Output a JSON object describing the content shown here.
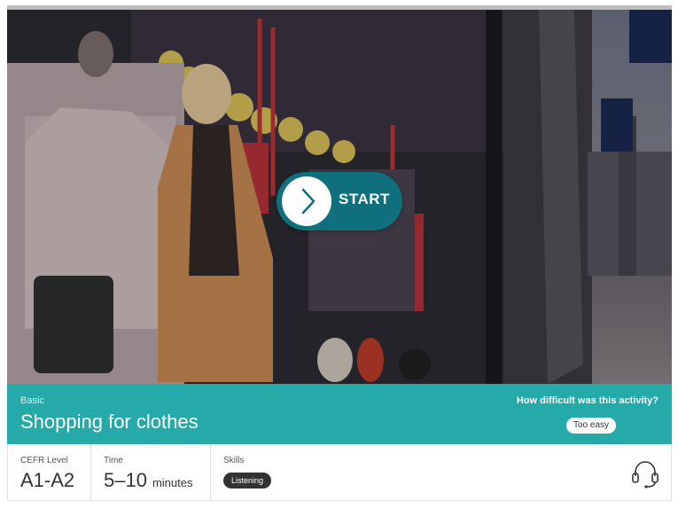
{
  "hero": {
    "start_label": "START",
    "icons": {
      "play": "chevron-right-icon"
    }
  },
  "activity": {
    "level": "Basic",
    "title": "Shopping for clothes",
    "difficulty_question": "How difficult was this activity?",
    "difficulty_answer": "Too easy"
  },
  "meta": {
    "cefr_label": "CEFR Level",
    "cefr_value": "A1-A2",
    "time_label": "Time",
    "time_value": "5–10",
    "time_unit": "minutes",
    "skills_label": "Skills",
    "skill": "Listening",
    "skill_icon": "headset-icon"
  },
  "colors": {
    "accent": "#26a9a9",
    "start_button": "#0f6f7d"
  }
}
